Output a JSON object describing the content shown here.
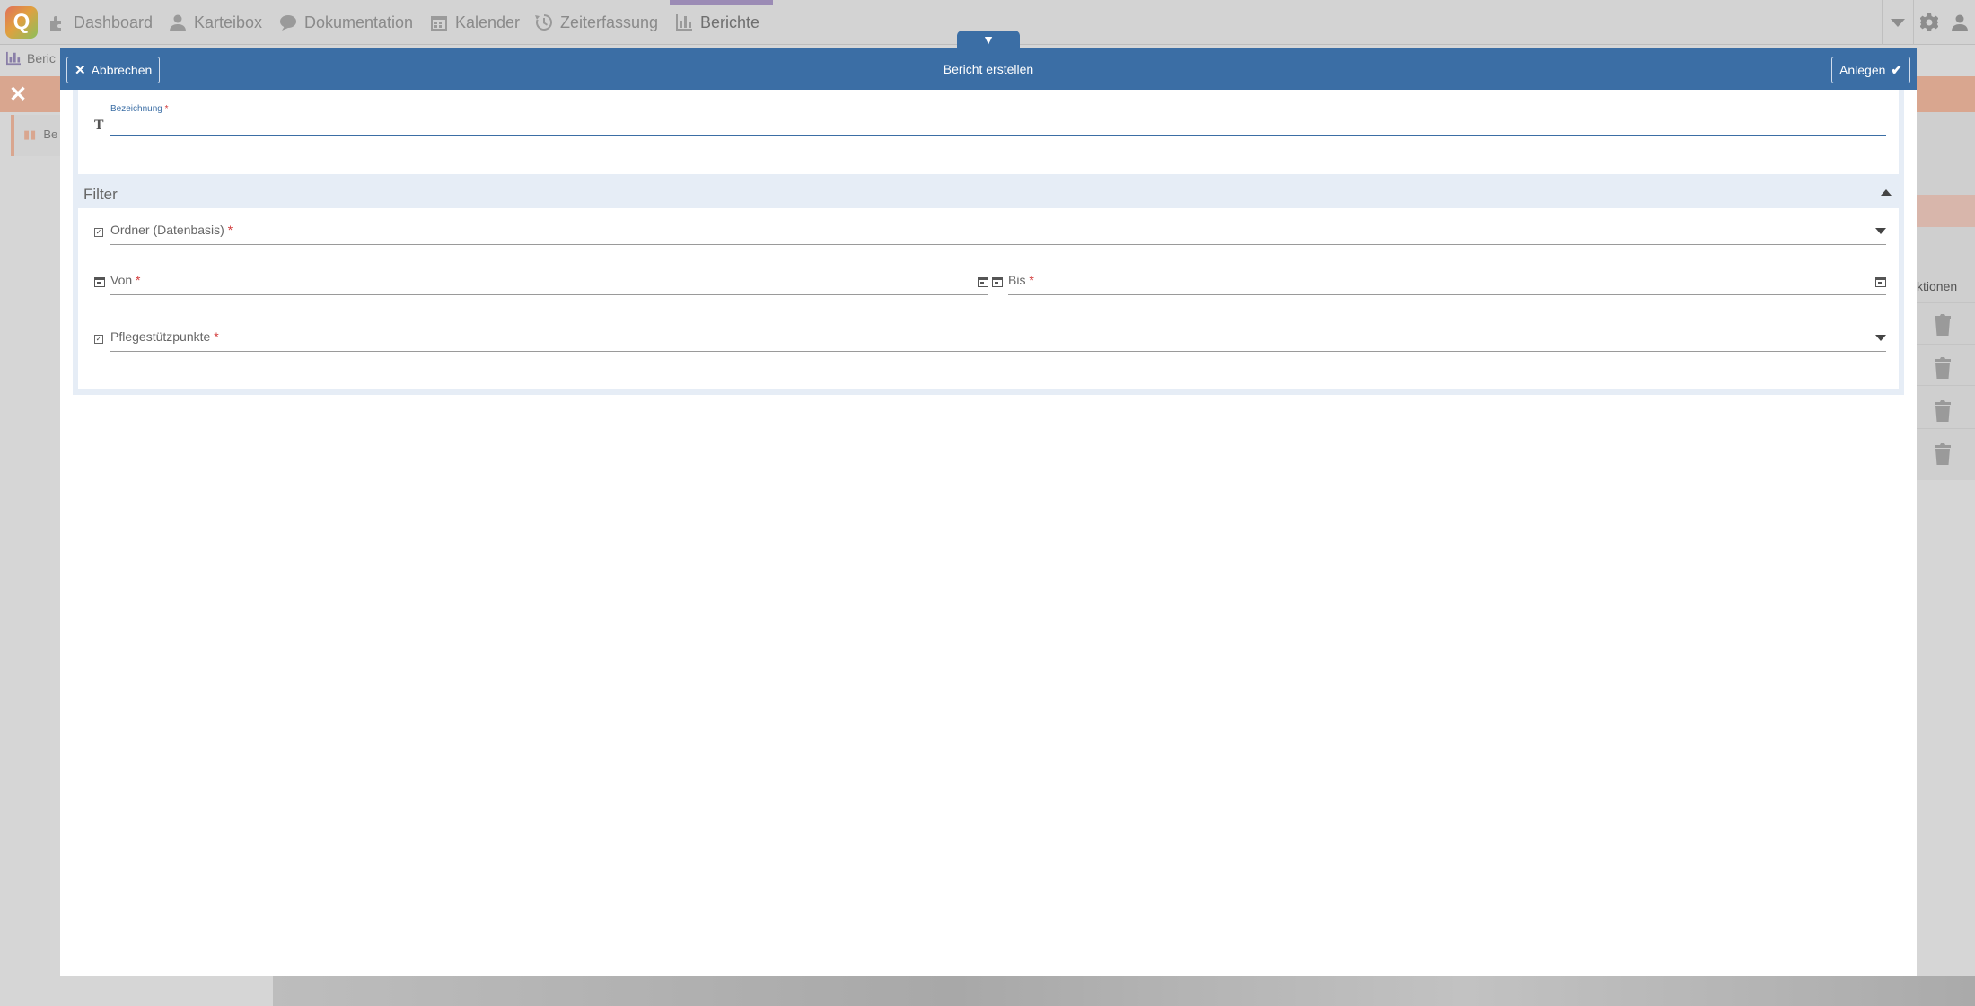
{
  "nav": {
    "logo_letter": "Q",
    "items": [
      {
        "label": "Dashboard",
        "icon": "puzzle-icon"
      },
      {
        "label": "Karteibox",
        "icon": "user-icon"
      },
      {
        "label": "Dokumentation",
        "icon": "speech-bubble-icon"
      },
      {
        "label": "Kalender",
        "icon": "calendar-icon"
      },
      {
        "label": "Zeiterfassung",
        "icon": "history-icon"
      },
      {
        "label": "Berichte",
        "icon": "bar-chart-icon",
        "active": true
      }
    ]
  },
  "subbar": {
    "tab_label": "Beric"
  },
  "background": {
    "card_label": "Be",
    "aktionen_label": "ktionen"
  },
  "modal": {
    "toggle_glyph": "▼",
    "title": "Bericht erstellen",
    "cancel_label": "Abbrechen",
    "create_label": "Anlegen",
    "bezeichnung": {
      "label": "Bezeichnung",
      "required_mark": "*",
      "value": ""
    },
    "filter": {
      "title": "Filter",
      "ordner": {
        "label": "Ordner (Datenbasis)",
        "required_mark": "*"
      },
      "von": {
        "label": "Von",
        "required_mark": "*"
      },
      "bis": {
        "label": "Bis",
        "required_mark": "*"
      },
      "pflege": {
        "label": "Pflegestützpunkte",
        "required_mark": "*"
      }
    }
  },
  "colors": {
    "header_blue": "#3b6ea5",
    "required_red": "#d23b3b",
    "section_bg": "#e6edf6"
  }
}
